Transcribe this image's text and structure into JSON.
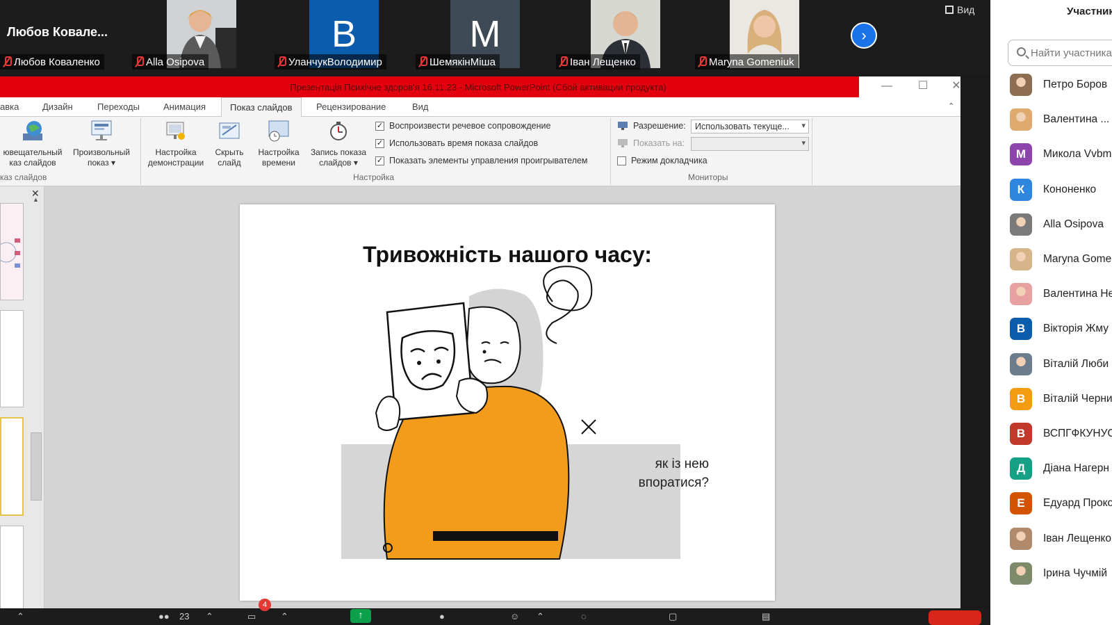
{
  "video_strip": {
    "active_speaker": "Любов  Ковале...",
    "tiles": [
      {
        "name": "Любов Коваленко",
        "type": "none"
      },
      {
        "name": "Alla Osipova",
        "type": "photo"
      },
      {
        "name": "УланчукВолодимир",
        "type": "letter",
        "letter": "B",
        "color": "#0b5cad"
      },
      {
        "name": "ШемякінМіша",
        "type": "letter",
        "letter": "M",
        "color": "#3e4a55"
      },
      {
        "name": "Іван Лещенко",
        "type": "photo"
      },
      {
        "name": "Maryna Gomeniuk",
        "type": "photo"
      }
    ],
    "next_icon": "chevron-right-icon",
    "view_label": "Вид"
  },
  "ppt": {
    "window_title": "Презентація Психічне здоров'я 16.11.23 - Microsoft PowerPoint (Сбой активации продукта)",
    "tabs": [
      "авка",
      "Дизайн",
      "Переходы",
      "Анимация",
      "Показ слайдов",
      "Рецензирование",
      "Вид"
    ],
    "active_tab": "Показ слайдов",
    "ribbon": {
      "start_group": {
        "btn1": [
          "ювещательный",
          "каз слайдов"
        ],
        "btn2": [
          "Произвольный",
          "показ ▾"
        ],
        "label": "каз слайдов"
      },
      "setup_group": {
        "btn_setup": [
          "Настройка",
          "демонстрации"
        ],
        "btn_hide": [
          "Скрыть",
          "слайд"
        ],
        "btn_timing": [
          "Настройка",
          "времени"
        ],
        "btn_record": [
          "Запись показа",
          "слайдов ▾"
        ],
        "checks": [
          {
            "label": "Воспроизвести речевое сопровождение",
            "checked": true
          },
          {
            "label": "Использовать время показа слайдов",
            "checked": true
          },
          {
            "label": "Показать элементы управления проигрывателем",
            "checked": true
          }
        ],
        "label": "Настройка"
      },
      "monitors_group": {
        "resolution_label": "Разрешение:",
        "resolution_value": "Использовать текуще...",
        "show_on_label": "Показать на:",
        "show_on_value": "",
        "presenter_mode_label": "Режим докладчика",
        "presenter_mode_checked": false,
        "label": "Мониторы"
      }
    },
    "slide": {
      "title": "Тривожність нашого часу:",
      "caption_line1": "як із нею",
      "caption_line2": "впоратися?"
    }
  },
  "bottom_bar": {
    "participants_count": "23",
    "chat_badge": "4"
  },
  "participants_panel": {
    "title": "Участники",
    "search_placeholder": "Найти участника",
    "items": [
      {
        "name": "Петро Боров",
        "avatar": "photo",
        "color": "#8d6e52"
      },
      {
        "name": "Валентина ...",
        "avatar": "photo",
        "color": "#e0a96d"
      },
      {
        "name": "Микола Vvbm",
        "avatar": "М",
        "color": "#8e44ad"
      },
      {
        "name": "Кононенко",
        "avatar": "К",
        "color": "#2e86de"
      },
      {
        "name": "Alla Osipova",
        "avatar": "photo",
        "color": "#7a7a7a"
      },
      {
        "name": "Maryna Gome",
        "avatar": "photo",
        "color": "#d8b48a"
      },
      {
        "name": "Валентина Не",
        "avatar": "photo",
        "color": "#e7a1a1"
      },
      {
        "name": "Вікторія Жму",
        "avatar": "В",
        "color": "#0b5cad"
      },
      {
        "name": "Віталій Люби",
        "avatar": "photo",
        "color": "#6b7d8c"
      },
      {
        "name": "Віталій Черни",
        "avatar": "В",
        "color": "#f39c12"
      },
      {
        "name": "ВСПГФКУНУС",
        "avatar": "В",
        "color": "#c0392b"
      },
      {
        "name": "Діана Нагерн",
        "avatar": "Д",
        "color": "#16a085"
      },
      {
        "name": "Едуард Проко",
        "avatar": "Е",
        "color": "#d35400"
      },
      {
        "name": "Іван Лещенко",
        "avatar": "photo",
        "color": "#b08a6a"
      },
      {
        "name": "Ірина Чучмій",
        "avatar": "photo",
        "color": "#7d8b6a"
      }
    ]
  }
}
